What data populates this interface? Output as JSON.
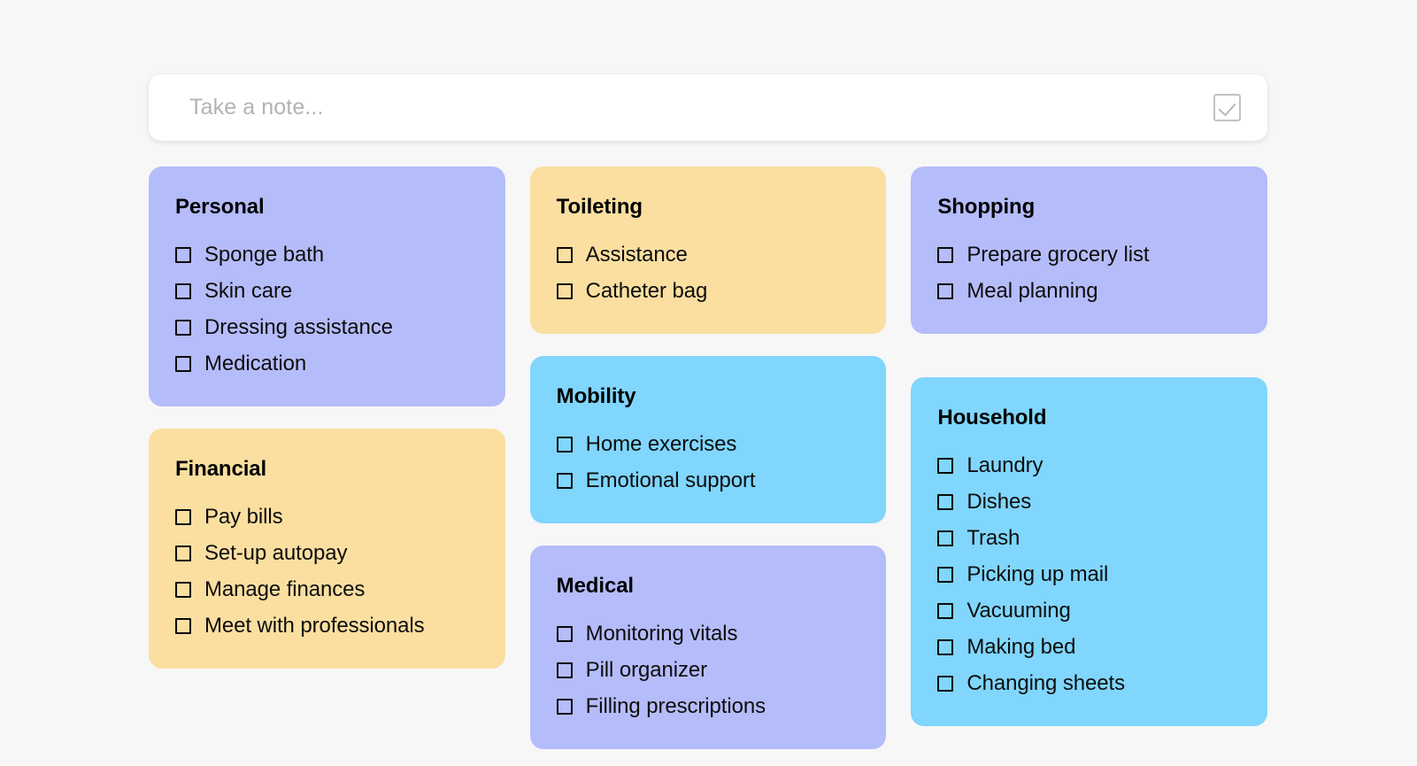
{
  "composer": {
    "placeholder": "Take a note...",
    "value": "",
    "toggle_icon": "checkbox-checked-icon"
  },
  "colors": {
    "background": "#f7f7f8",
    "purple": "#b5bcfa",
    "yellow": "#fadfa1",
    "blue": "#80d6fd",
    "text": "#0d0d0d",
    "placeholder": "#b3b3b6"
  },
  "columns": [
    {
      "cards": [
        {
          "title": "Personal",
          "theme": "purple",
          "items": [
            {
              "label": "Sponge bath",
              "checked": false
            },
            {
              "label": "Skin care",
              "checked": false
            },
            {
              "label": "Dressing assistance",
              "checked": false
            },
            {
              "label": "Medication",
              "checked": false
            }
          ]
        },
        {
          "title": "Financial",
          "theme": "yellow",
          "items": [
            {
              "label": "Pay bills",
              "checked": false
            },
            {
              "label": "Set-up autopay",
              "checked": false
            },
            {
              "label": "Manage finances",
              "checked": false
            },
            {
              "label": "Meet with professionals",
              "checked": false
            }
          ]
        }
      ]
    },
    {
      "cards": [
        {
          "title": "Toileting",
          "theme": "yellow",
          "items": [
            {
              "label": "Assistance",
              "checked": false
            },
            {
              "label": "Catheter bag",
              "checked": false
            }
          ]
        },
        {
          "title": "Mobility",
          "theme": "blue",
          "items": [
            {
              "label": "Home exercises",
              "checked": false
            },
            {
              "label": "Emotional support",
              "checked": false
            }
          ]
        },
        {
          "title": "Medical",
          "theme": "purple",
          "items": [
            {
              "label": "Monitoring vitals",
              "checked": false
            },
            {
              "label": "Pill organizer",
              "checked": false
            },
            {
              "label": "Filling prescriptions",
              "checked": false
            }
          ]
        }
      ]
    },
    {
      "cards": [
        {
          "title": "Shopping",
          "theme": "purple",
          "items": [
            {
              "label": "Prepare grocery list",
              "checked": false
            },
            {
              "label": "Meal planning",
              "checked": false
            }
          ]
        },
        {
          "title": "Household",
          "theme": "blue",
          "items": [
            {
              "label": "Laundry",
              "checked": false
            },
            {
              "label": "Dishes",
              "checked": false
            },
            {
              "label": "Trash",
              "checked": false
            },
            {
              "label": "Picking up mail",
              "checked": false
            },
            {
              "label": "Vacuuming",
              "checked": false
            },
            {
              "label": "Making bed",
              "checked": false
            },
            {
              "label": "Changing sheets",
              "checked": false
            }
          ]
        }
      ]
    }
  ]
}
